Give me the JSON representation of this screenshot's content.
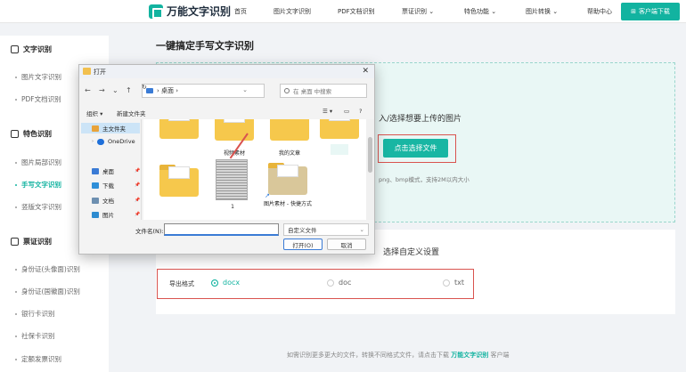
{
  "brand": {
    "name": "万能文字识别",
    "accent": "#12b3a0",
    "highlight": "#d9534f"
  },
  "nav": [
    {
      "label": "首页"
    },
    {
      "label": "图片文字识别"
    },
    {
      "label": "PDF文档识别"
    },
    {
      "label": "票证识别 ⌄"
    },
    {
      "label": "特色功能 ⌄"
    },
    {
      "label": "图片转换 ⌄"
    },
    {
      "label": "帮助中心"
    }
  ],
  "download_button": "客户端下载",
  "sidebar": {
    "sections": [
      {
        "title": "文字识别",
        "items": [
          "图片文字识别",
          "PDF文档识别"
        ]
      },
      {
        "title": "特色识别",
        "items": [
          "图片局部识别",
          "手写文字识别",
          "竖版文字识别"
        ]
      },
      {
        "title": "票证识别",
        "items": [
          "身份证(头像面)识别",
          "身份证(国徽面)识别",
          "银行卡识别",
          "社保卡识别",
          "定额发票识别"
        ]
      }
    ],
    "active": "手写文字识别"
  },
  "main": {
    "title": "一键搞定手写文字识别",
    "upload_hint": "入/选择想要上传的图片",
    "choose_button": "点击选择文件",
    "format_hint": "png、bmp模式，支持2M以内大小",
    "settings_title": "选择自定义设置",
    "export_label": "导出格式",
    "formats": [
      {
        "label": "docx",
        "selected": true
      },
      {
        "label": "doc",
        "selected": false
      },
      {
        "label": "txt",
        "selected": false
      }
    ]
  },
  "footer": {
    "text": "如需识别更多更大的文件，转换不同格式文件，请点击下载",
    "link": "万能文字识别",
    "suffix": "客户端"
  },
  "dialog": {
    "title": "打开",
    "path": "桌面",
    "search_placeholder": "在 桌面 中搜索",
    "toolbar": {
      "organize": "组织 ▾",
      "new_folder": "新建文件夹"
    },
    "side_items": [
      {
        "label": "主文件夹",
        "icon": "home-icon",
        "color": "#e8a33a"
      },
      {
        "label": "OneDrive",
        "icon": "cloud-icon",
        "color": "#1e6fd9"
      },
      {
        "label": "桌面",
        "icon": "desktop-icon",
        "color": "#3a7bd5"
      },
      {
        "label": "下载",
        "icon": "download-icon",
        "color": "#2f8fd8"
      },
      {
        "label": "文档",
        "icon": "document-icon",
        "color": "#6d8fb0"
      },
      {
        "label": "图片",
        "icon": "picture-icon",
        "color": "#2d8bd0"
      }
    ],
    "files": [
      {
        "label": "视频素材"
      },
      {
        "label": "我的文章"
      },
      {
        "label": "1"
      },
      {
        "label": "图片素材 - 快捷方式"
      }
    ],
    "file_name_label": "文件名(N):",
    "file_name_value": "",
    "file_type": "自定义文件",
    "open_button": "打开(O)",
    "cancel_button": "取消"
  }
}
